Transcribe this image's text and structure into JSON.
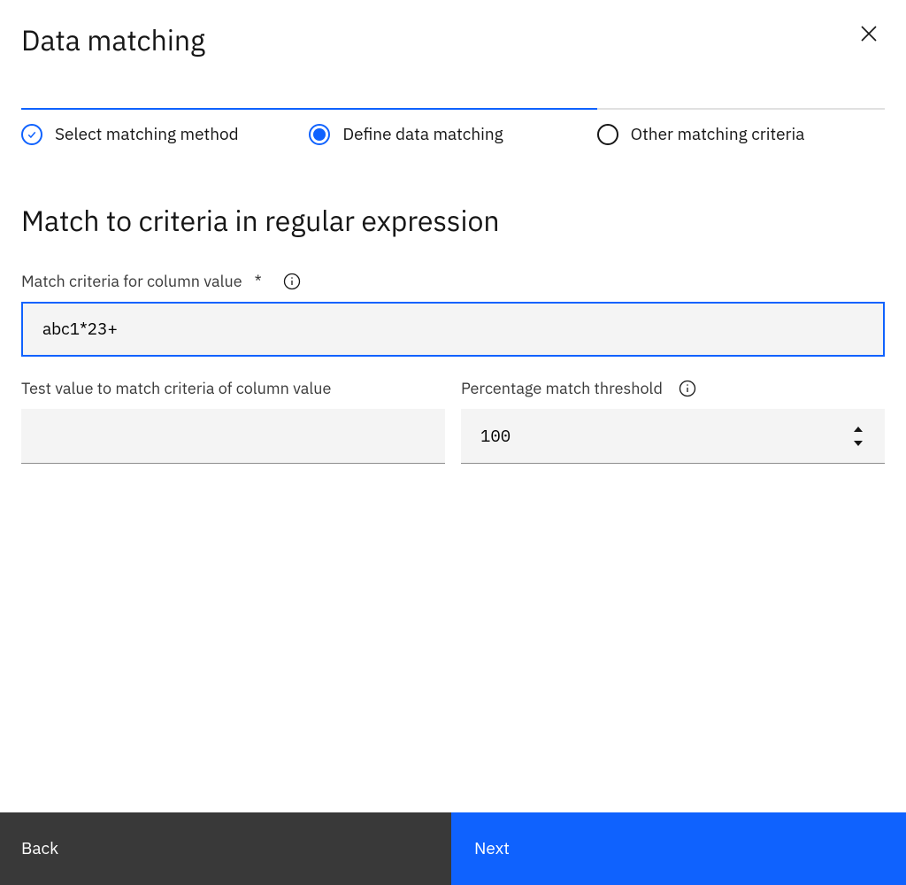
{
  "header": {
    "title": "Data matching"
  },
  "progress": {
    "percent_complete": 66.7,
    "steps": [
      {
        "label": "Select matching method",
        "state": "complete"
      },
      {
        "label": "Define data matching",
        "state": "current"
      },
      {
        "label": "Other matching criteria",
        "state": "incomplete"
      }
    ]
  },
  "section": {
    "title": "Match to criteria in regular expression"
  },
  "fields": {
    "match_criteria": {
      "label": "Match criteria for column value",
      "required_marker": "*",
      "value": "abc1*23+"
    },
    "test_value": {
      "label": "Test value to match criteria of column value",
      "value": ""
    },
    "threshold": {
      "label": "Percentage match threshold",
      "value": "100"
    }
  },
  "footer": {
    "back": "Back",
    "next": "Next"
  }
}
